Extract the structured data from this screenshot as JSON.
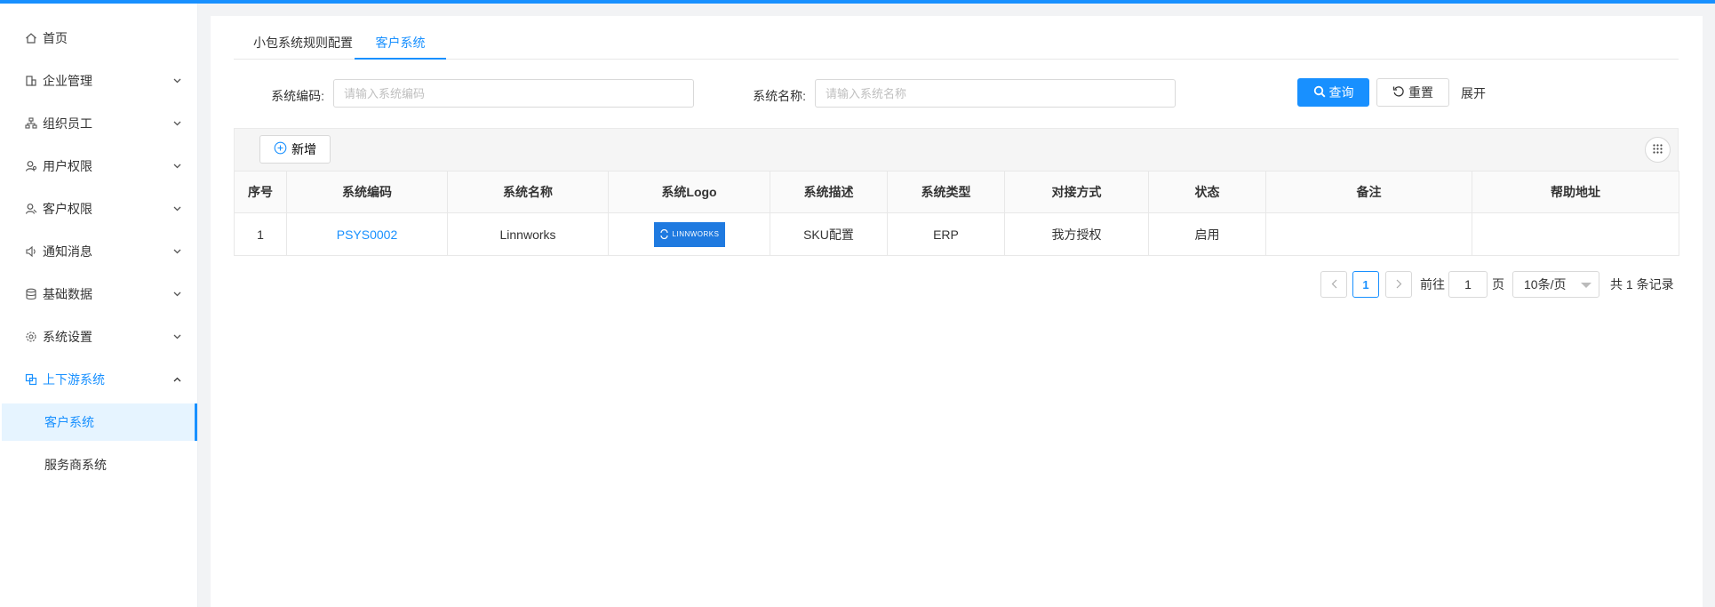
{
  "sidebar": {
    "items": [
      {
        "label": "首页",
        "icon": "home-icon",
        "has_children": false
      },
      {
        "label": "企业管理",
        "icon": "building-icon",
        "has_children": true
      },
      {
        "label": "组织员工",
        "icon": "org-chart-icon",
        "has_children": true
      },
      {
        "label": "用户权限",
        "icon": "user-key-icon",
        "has_children": true
      },
      {
        "label": "客户权限",
        "icon": "customer-key-icon",
        "has_children": true
      },
      {
        "label": "通知消息",
        "icon": "speaker-icon",
        "has_children": true
      },
      {
        "label": "基础数据",
        "icon": "database-icon",
        "has_children": true
      },
      {
        "label": "系统设置",
        "icon": "gear-icon",
        "has_children": true
      },
      {
        "label": "上下游系统",
        "icon": "systems-icon",
        "has_children": true,
        "expanded": true
      }
    ],
    "sub_items": [
      {
        "label": "客户系统",
        "active": true
      },
      {
        "label": "服务商系统",
        "active": false
      }
    ]
  },
  "tabs": [
    {
      "label": "小包系统规则配置",
      "active": false
    },
    {
      "label": "客户系统",
      "active": true
    }
  ],
  "search": {
    "code_label": "系统编码:",
    "code_placeholder": "请输入系统编码",
    "code_value": "",
    "name_label": "系统名称:",
    "name_placeholder": "请输入系统名称",
    "name_value": "",
    "query_button": "查询",
    "reset_button": "重置",
    "expand_link": "展开"
  },
  "toolbar": {
    "add_button": "新增"
  },
  "table": {
    "columns": [
      "序号",
      "系统编码",
      "系统名称",
      "系统Logo",
      "系统描述",
      "系统类型",
      "对接方式",
      "状态",
      "备注",
      "帮助地址"
    ],
    "rows": [
      {
        "index": "1",
        "code": "PSYS0002",
        "name": "Linnworks",
        "logo_text": "LINNWORKS",
        "description": "SKU配置",
        "type": "ERP",
        "integration": "我方授权",
        "status": "启用",
        "remark": "",
        "help_url": ""
      }
    ]
  },
  "pagination": {
    "current_page": "1",
    "goto_label": "前往",
    "goto_value": "1",
    "page_suffix": "页",
    "page_size": "10条/页",
    "total_text": "共 1 条记录"
  },
  "colors": {
    "accent": "#1890ff",
    "logo_bg": "#1f7ae0"
  }
}
